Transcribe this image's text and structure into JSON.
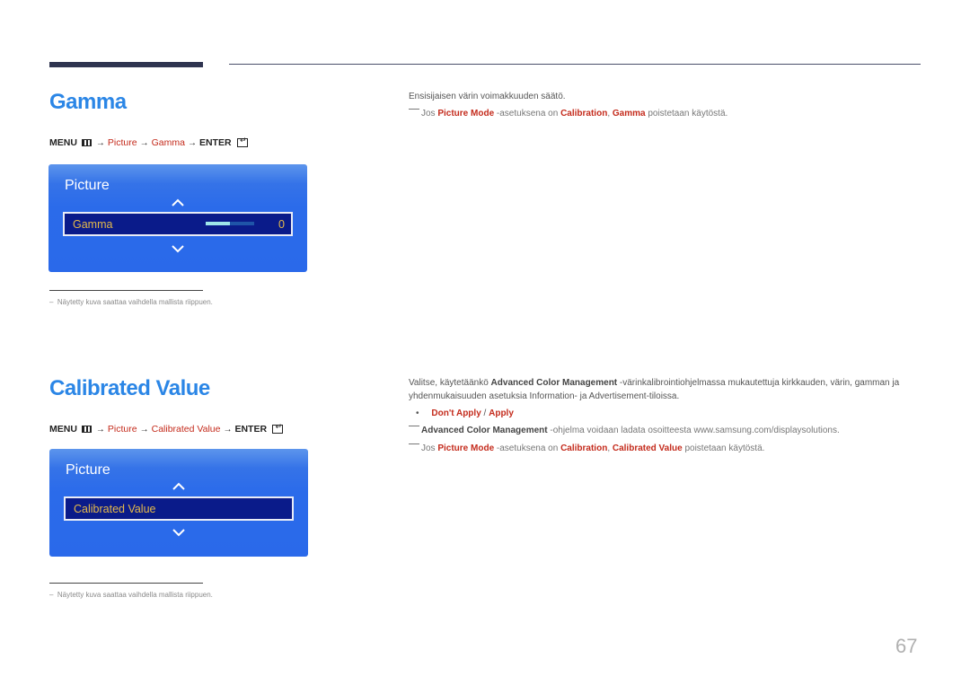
{
  "sections": [
    {
      "title": "Gamma",
      "menu_path": {
        "menu": "MENU",
        "arrow": "→",
        "steps": [
          "Picture",
          "Gamma"
        ],
        "enter": "ENTER"
      },
      "osd": {
        "title": "Picture",
        "item_label": "Gamma",
        "item_value": "0",
        "slider_fraction": 0.5
      },
      "footnote": "Näytetty kuva saattaa vaihdella mallista riippuen.",
      "description": "Ensisijaisen värin voimakkuuden säätö.",
      "notes": [
        {
          "parts": [
            {
              "text": "Jos ",
              "style": "plain"
            },
            {
              "text": "Picture Mode",
              "style": "red"
            },
            {
              "text": " -asetuksena on ",
              "style": "plain"
            },
            {
              "text": "Calibration",
              "style": "red"
            },
            {
              "text": ", ",
              "style": "plain"
            },
            {
              "text": "Gamma",
              "style": "red"
            },
            {
              "text": " poistetaan käytöstä.",
              "style": "plain"
            }
          ]
        }
      ]
    },
    {
      "title": "Calibrated Value",
      "menu_path": {
        "menu": "MENU",
        "arrow": "→",
        "steps": [
          "Picture",
          "Calibrated Value"
        ],
        "enter": "ENTER"
      },
      "osd": {
        "title": "Picture",
        "item_label": "Calibrated Value"
      },
      "footnote": "Näytetty kuva saattaa vaihdella mallista riippuen.",
      "description_parts": [
        {
          "text": "Valitse, käytetäänkö ",
          "style": "plain"
        },
        {
          "text": "Advanced Color Management",
          "style": "dark"
        },
        {
          "text": " -värinkalibrointiohjelmassa mukautettuja kirkkauden, värin, gamman ja yhdenmukaisuuden asetuksia Information- ja Advertisement-tiloissa.",
          "style": "plain"
        }
      ],
      "options": {
        "first": "Don't Apply",
        "separator": " / ",
        "second": "Apply"
      },
      "notes": [
        {
          "parts": [
            {
              "text": "Advanced Color Management",
              "style": "dark"
            },
            {
              "text": " -ohjelma voidaan ladata osoitteesta www.samsung.com/displaysolutions.",
              "style": "plain"
            }
          ]
        },
        {
          "parts": [
            {
              "text": "Jos ",
              "style": "plain"
            },
            {
              "text": "Picture Mode",
              "style": "red"
            },
            {
              "text": " -asetuksena on ",
              "style": "plain"
            },
            {
              "text": "Calibration",
              "style": "red"
            },
            {
              "text": ", ",
              "style": "plain"
            },
            {
              "text": "Calibrated Value",
              "style": "red"
            },
            {
              "text": " poistetaan käytöstä.",
              "style": "plain"
            }
          ]
        }
      ]
    }
  ],
  "icons": {
    "menu": "menu-grid-icon",
    "enter": "enter-icon",
    "up": "chevron-up-icon",
    "down": "chevron-down-icon"
  },
  "colors": {
    "title_blue": "#2b86e6",
    "emphasis_red": "#c42b1c",
    "osd_blue": "#2a69ea",
    "osd_item_bg": "#0a1b8a",
    "osd_item_text": "#e5b94a"
  },
  "page_number": "67"
}
